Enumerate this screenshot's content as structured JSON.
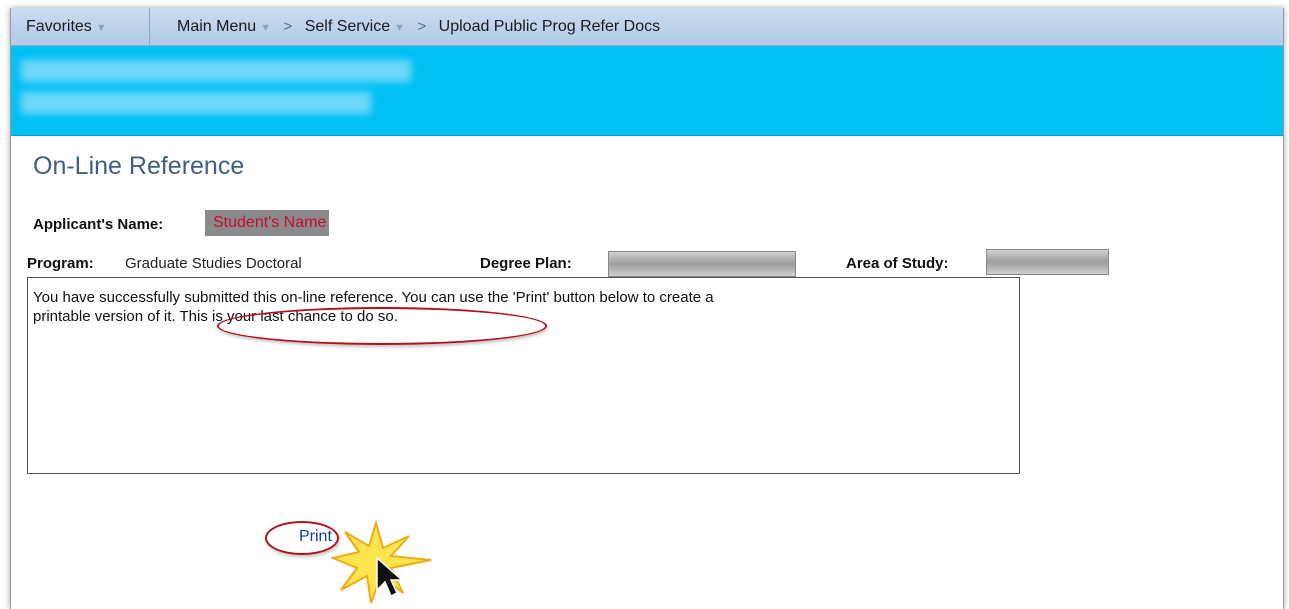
{
  "nav": {
    "favorites": "Favorites",
    "breadcrumbs": [
      {
        "label": "Main Menu",
        "dropdown": true
      },
      {
        "label": "Self Service",
        "dropdown": true
      },
      {
        "label": "Upload Public Prog Refer Docs",
        "dropdown": false
      }
    ]
  },
  "page": {
    "title": "On-Line Reference"
  },
  "applicant": {
    "name_label": "Applicant's Name:",
    "name_value": "Student's Name",
    "program_label": "Program:",
    "program_value": "Graduate Studies Doctoral",
    "degree_plan_label": "Degree Plan:",
    "area_of_study_label": "Area of Study:"
  },
  "message": {
    "line1": "You have successfully submitted this on-line reference.  You can use the 'Print' button below to create a",
    "line2_a": "printable version of it. ",
    "line2_b": "This is your last chance to do so."
  },
  "actions": {
    "print_label": "Print"
  },
  "colors": {
    "navbar": "#c9dcf1",
    "banner": "#00c0f4",
    "title": "#3e5f86",
    "highlight_oval": "#b0111a",
    "link": "#103e9c"
  }
}
